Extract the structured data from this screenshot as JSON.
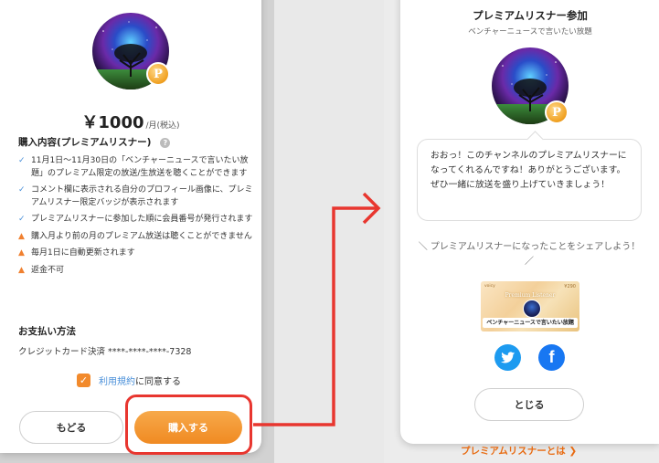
{
  "left_panel": {
    "price": "￥1000",
    "price_unit": "/月(税込)",
    "badge_letter": "P",
    "section_title": "購入内容(プレミアムリスナー)",
    "help_icon": "?",
    "terms": [
      {
        "kind": "check",
        "icon": "check-icon",
        "text": "11月1日〜11月30日の「ベンチャーニュースで言いたい放題」のプレミアム限定の放送/生放送を聴くことができます"
      },
      {
        "kind": "check",
        "icon": "check-icon",
        "text": "コメント欄に表示される自分のプロフィール画像に、プレミアムリスナー限定バッジが表示されます"
      },
      {
        "kind": "check",
        "icon": "check-icon",
        "text": "プレミアムリスナーに参加した順に会員番号が発行されます"
      },
      {
        "kind": "warn",
        "icon": "warning-icon",
        "text": "購入月より前の月のプレミアム放送は聴くことができません"
      },
      {
        "kind": "warn",
        "icon": "warning-icon",
        "text": "毎月1日に自動更新されます"
      },
      {
        "kind": "warn",
        "icon": "warning-icon",
        "text": "返金不可"
      }
    ],
    "payment_title": "お支払い方法",
    "payment_method": "クレジットカード決済 ****-****-****-7328",
    "agree_link": "利用規約",
    "agree_text": "に同意する",
    "back_button": "もどる",
    "buy_button": "購入する"
  },
  "right_panel": {
    "title": "プレミアムリスナー参加",
    "subtitle": "ベンチャーニュースで言いたい放題",
    "badge_letter": "P",
    "message": "おおっ！このチャンネルのプレミアムリスナーになってくれるんですね！ありがとうございます。ぜひ一緒に放送を盛り上げていきましょう！",
    "share_text": "＼ プレミアムリスナーになったことをシェアしよう！ ／",
    "sticker": {
      "top_label": "voicy",
      "price_label": "¥290",
      "title": "Premium Listener",
      "banner": "ベンチャーニュースで言いたい放題"
    },
    "twitter_icon": "twitter-icon",
    "facebook_icon": "facebook-icon",
    "close_button": "とじる",
    "bottom_link": "プレミアムリスナーとは",
    "bottom_link_arrow": "❯"
  },
  "colors": {
    "accent_orange": "#f08a22",
    "highlight_red": "#e8362f",
    "link_blue": "#4a90d9",
    "twitter_blue": "#1d9bf0",
    "facebook_blue": "#1877f2"
  }
}
